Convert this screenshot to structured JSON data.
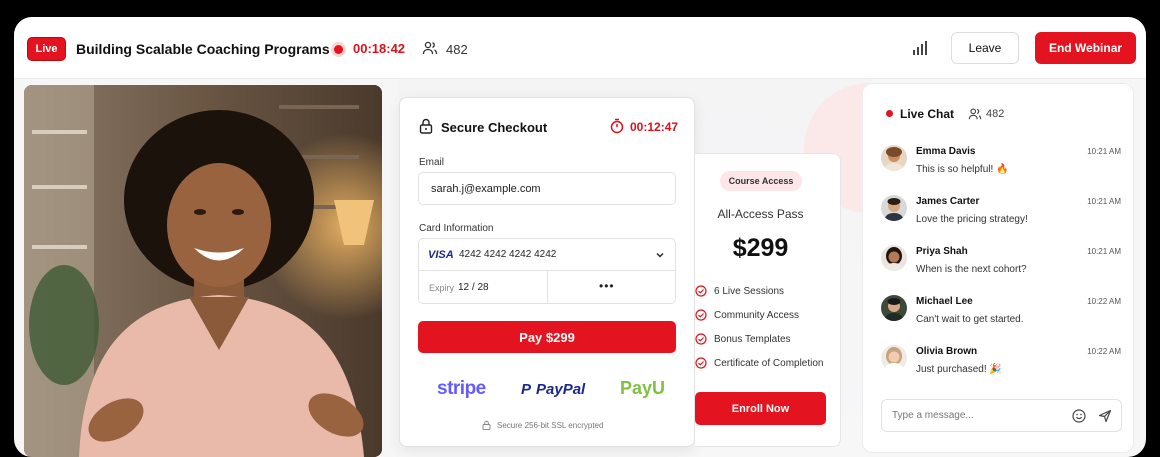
{
  "header": {
    "live_label": "Live",
    "title": "Building Scalable Coaching Programs",
    "elapsed": "00:18:42",
    "viewer_count": "482",
    "leave_label": "Leave",
    "end_label": "End Webinar"
  },
  "checkout": {
    "title": "Secure Checkout",
    "countdown": "00:12:47",
    "email_label": "Email",
    "email_value": "sarah.j@example.com",
    "card_label": "Card Information",
    "card_brand": "VISA",
    "card_number": "4242 4242 4242 4242",
    "expiry_label": "Expiry",
    "expiry_value": "12 / 28",
    "cvv_value": "•••",
    "pay_label": "Pay $299",
    "providers": [
      "stripe",
      "P",
      "PayPal",
      "PayU"
    ],
    "ssl_note": "Secure 256-bit SSL encrypted"
  },
  "course": {
    "badge": "Course Access",
    "name": "All-Access Pass",
    "price": "$299",
    "features": [
      "6 Live Sessions",
      "Community Access",
      "Bonus Templates",
      "Certificate of Completion"
    ],
    "enroll_label": "Enroll Now"
  },
  "chat": {
    "title": "Live Chat",
    "count": "482",
    "messages": [
      {
        "name": "Emma Davis",
        "time": "10:21 AM",
        "text": "This is so helpful! 🔥"
      },
      {
        "name": "James Carter",
        "time": "10:21 AM",
        "text": "Love the pricing strategy!"
      },
      {
        "name": "Priya Shah",
        "time": "10:21 AM",
        "text": "When is the next cohort?"
      },
      {
        "name": "Michael Lee",
        "time": "10:22 AM",
        "text": "Can't wait to get started."
      },
      {
        "name": "Olivia Brown",
        "time": "10:22 AM",
        "text": "Just purchased! 🎉"
      }
    ],
    "input_placeholder": "Type a message..."
  },
  "colors": {
    "accent": "#e3141f",
    "stripe": "#635bff",
    "paypal": "#1a2a8c",
    "payu": "#7fc241"
  }
}
